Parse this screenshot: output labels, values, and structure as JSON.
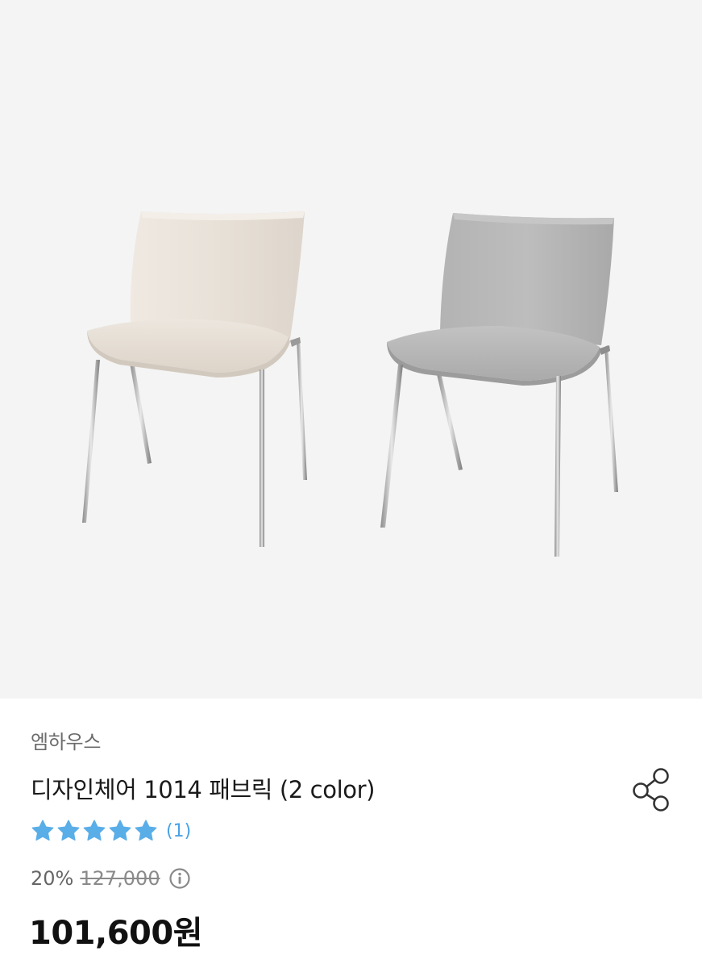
{
  "product": {
    "brand": "엠하우스",
    "title": "디자인체어 1014 패브릭 (2 color)",
    "rating": {
      "stars": 5,
      "max_stars": 5,
      "review_count_text": "(1)",
      "star_color": "#5aaee8"
    },
    "discount_percent": "20%",
    "original_price": "127,000",
    "price": "101,600원"
  },
  "icons": {
    "share": "share-icon",
    "info": "info-circle-icon",
    "star": "star-icon"
  },
  "colors": {
    "hero_background": "#f4f4f4",
    "chair_beige": "#e9e2da",
    "chair_grey": "#b9b9b9",
    "accent_blue": "#4aa3e6"
  }
}
